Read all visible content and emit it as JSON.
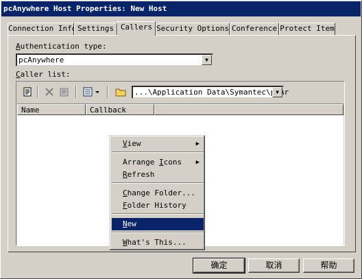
{
  "window": {
    "title": "pcAnywhere Host Properties: New Host"
  },
  "tabs": [
    {
      "label": "Connection Info"
    },
    {
      "label": "Settings"
    },
    {
      "label": "Callers",
      "active": true
    },
    {
      "label": "Security Options"
    },
    {
      "label": "Conference"
    },
    {
      "label": "Protect Item"
    }
  ],
  "auth": {
    "label_u": "A",
    "label_rest": "uthentication type:",
    "value": "pcAnywhere"
  },
  "caller_list": {
    "label_u": "C",
    "label_rest": "aller list:",
    "path": "...\\Application Data\\Symantec\\pcAr",
    "columns": [
      "Name",
      "Callback"
    ],
    "toolbar_icons": [
      "new-item-icon",
      "delete-icon",
      "properties-icon",
      "view-menu-icon",
      "folder-icon"
    ]
  },
  "context_menu": {
    "items": [
      {
        "u": "V",
        "rest": "iew",
        "submenu": true
      },
      {
        "pre": "Arrange ",
        "u": "I",
        "rest": "cons",
        "submenu": true
      },
      {
        "u": "R",
        "rest": "efresh"
      },
      {
        "u": "C",
        "rest": "hange Folder..."
      },
      {
        "u": "F",
        "rest": "older History"
      },
      {
        "u": "N",
        "rest": "ew",
        "selected": true
      },
      {
        "u": "W",
        "rest": "hat's This..."
      }
    ]
  },
  "buttons": {
    "ok": "确定",
    "cancel": "取消",
    "help": "帮助"
  },
  "colors": {
    "titlebar": "#0a246a",
    "highlight": "#0a246a",
    "face": "#d4d0c8"
  }
}
